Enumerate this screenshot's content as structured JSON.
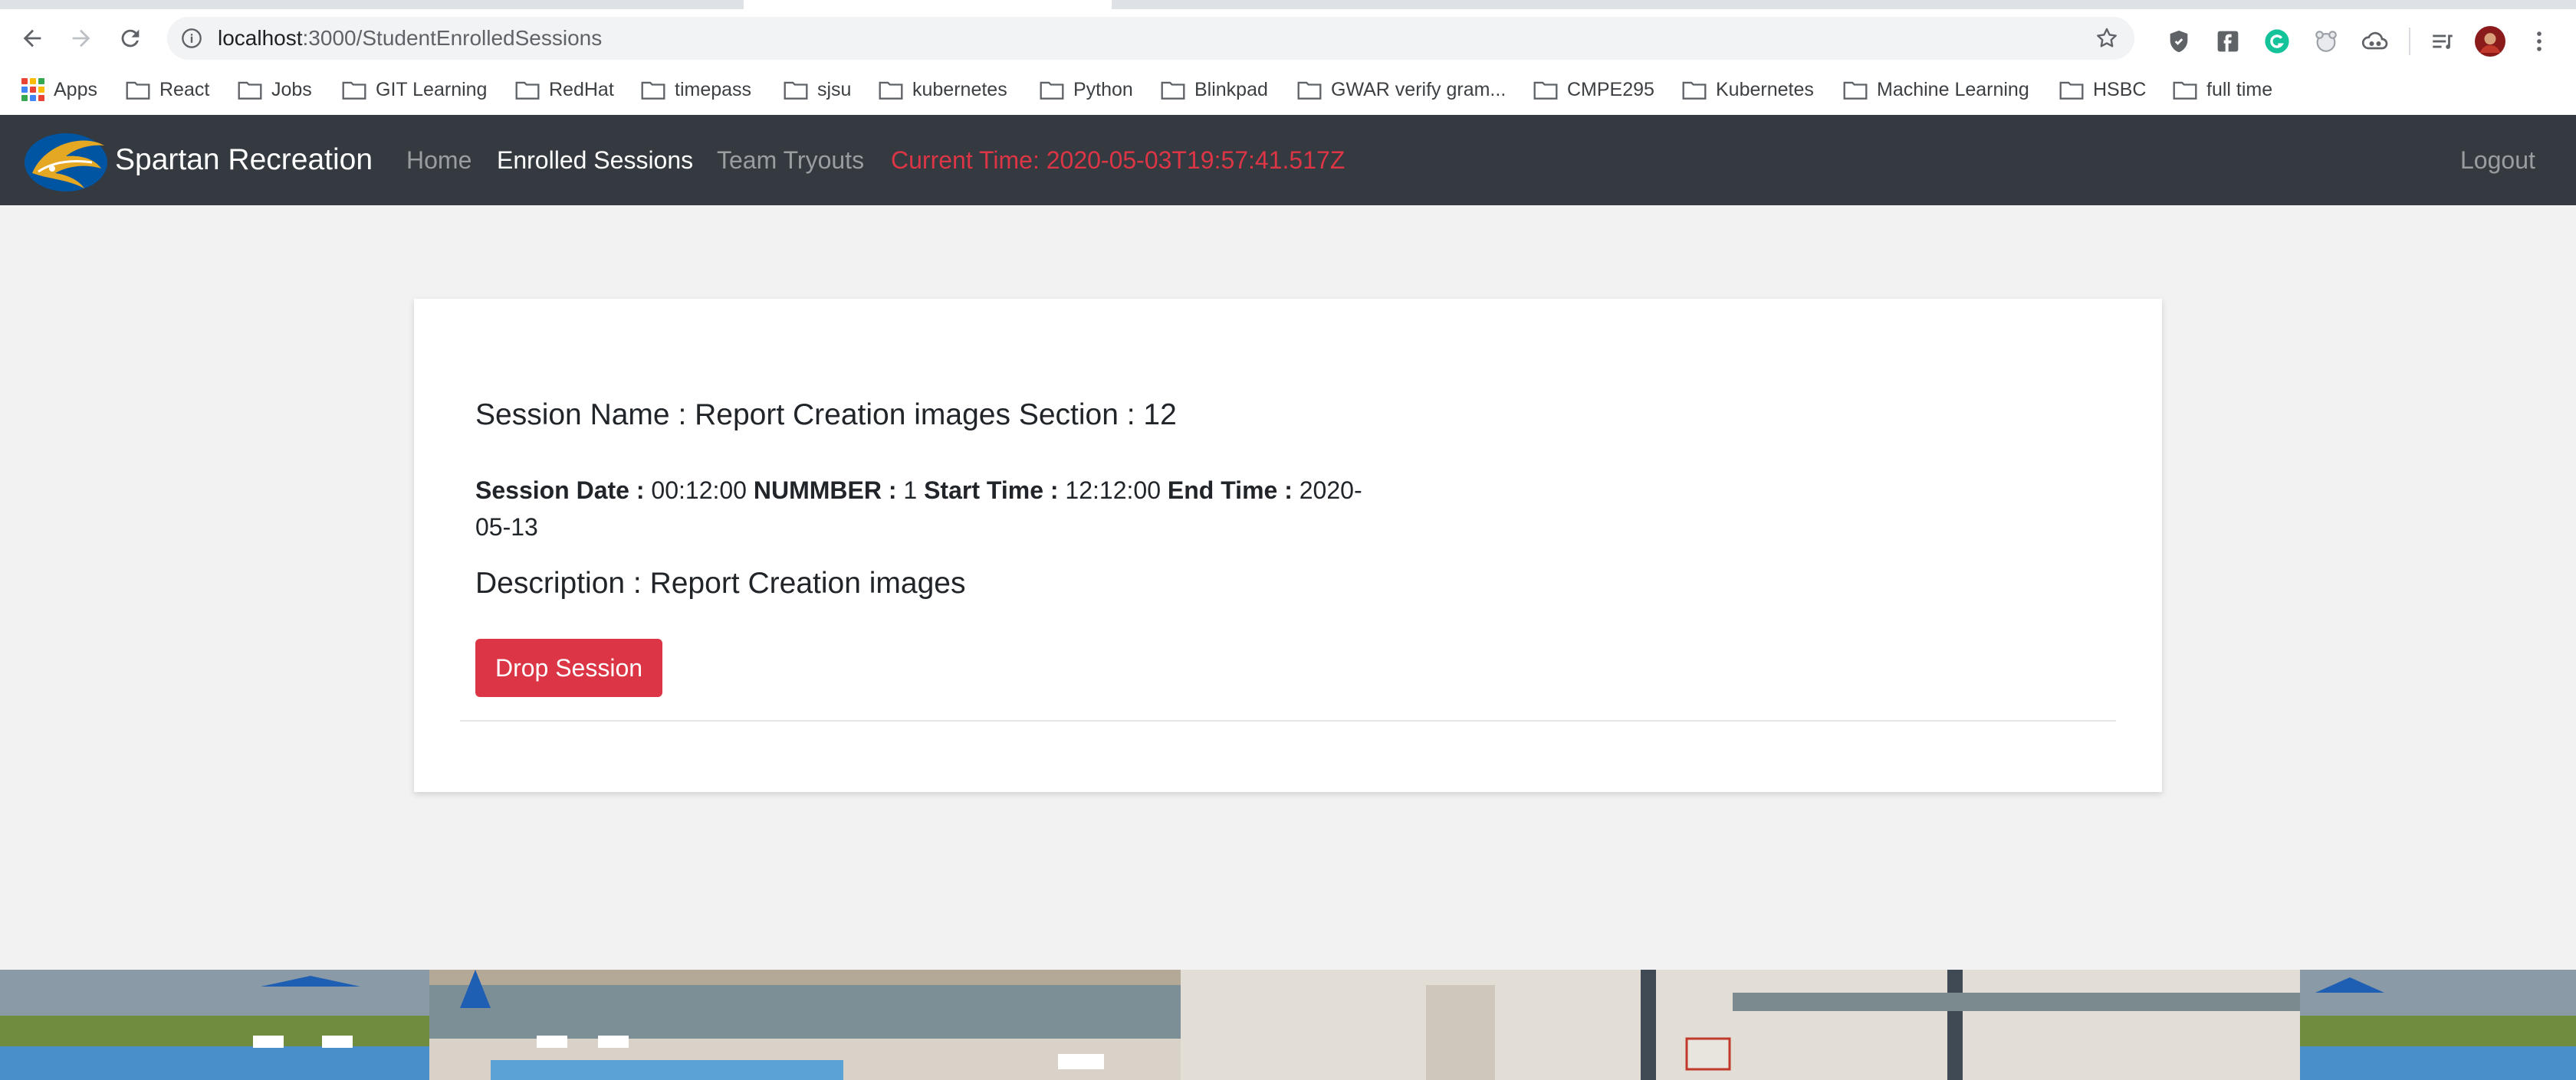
{
  "browser": {
    "url_host": "localhost",
    "url_path": ":3000/StudentEnrolledSessions",
    "bookmarks": [
      {
        "label": "Apps",
        "icon": "apps-grid-icon"
      },
      {
        "label": "React",
        "icon": "folder-icon"
      },
      {
        "label": "Jobs",
        "icon": "folder-icon"
      },
      {
        "label": "GIT Learning",
        "icon": "folder-icon"
      },
      {
        "label": "RedHat",
        "icon": "folder-icon"
      },
      {
        "label": "timepass",
        "icon": "folder-icon"
      },
      {
        "label": "sjsu",
        "icon": "folder-icon"
      },
      {
        "label": "kubernetes",
        "icon": "folder-icon"
      },
      {
        "label": "Python",
        "icon": "folder-icon"
      },
      {
        "label": "Blinkpad",
        "icon": "folder-icon"
      },
      {
        "label": "GWAR verify gram...",
        "icon": "folder-icon"
      },
      {
        "label": "CMPE295",
        "icon": "folder-icon"
      },
      {
        "label": "Kubernetes",
        "icon": "folder-icon"
      },
      {
        "label": "Machine Learning",
        "icon": "folder-icon"
      },
      {
        "label": "HSBC",
        "icon": "folder-icon"
      },
      {
        "label": "full time",
        "icon": "folder-icon"
      }
    ]
  },
  "navbar": {
    "brand": "Spartan Recreation",
    "links": {
      "home": "Home",
      "enrolled": "Enrolled Sessions",
      "tryouts": "Team Tryouts"
    },
    "current_time": "Current Time: 2020-05-03T19:57:41.517Z",
    "logout": "Logout"
  },
  "session": {
    "title": "Session Name : Report Creation images Section : 12",
    "date_label": "Session Date :",
    "date_value": "00:12:00",
    "number_label": "NUMMBER :",
    "number_value": "1",
    "start_label": "Start Time :",
    "start_value": "12:12:00",
    "end_label": "End Time :",
    "end_value": "2020-05-13",
    "description": "Description : Report Creation images",
    "drop_button": "Drop Session"
  },
  "colors": {
    "navbar_bg": "#343a40",
    "danger": "#dc3545",
    "page_bg": "#f2f2f2"
  }
}
